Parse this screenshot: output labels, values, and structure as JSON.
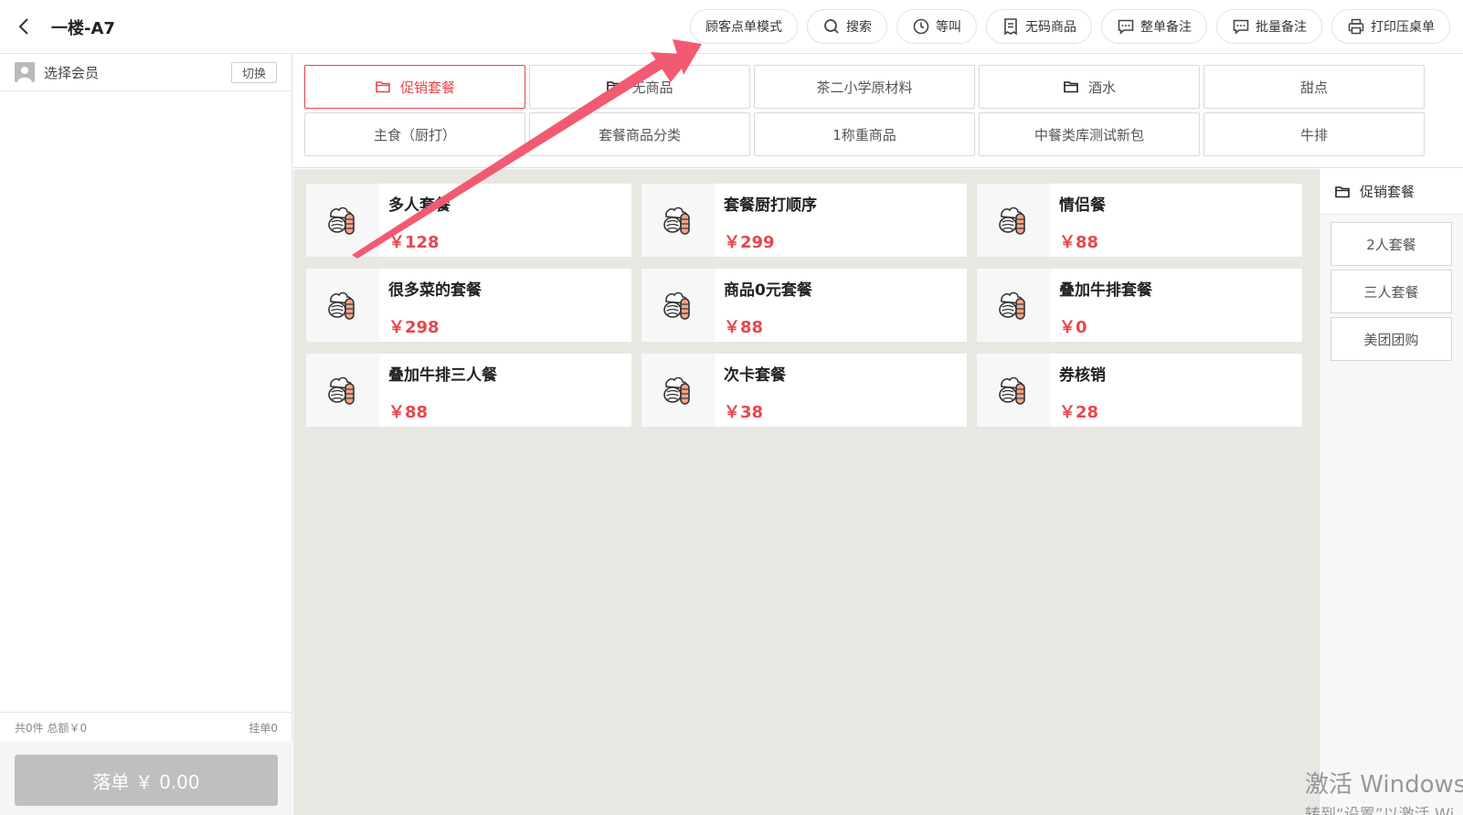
{
  "header": {
    "table_title": "一楼-A7",
    "actions": [
      {
        "label": "顾客点单模式",
        "icon": ""
      },
      {
        "label": "搜索",
        "icon": "search-icon"
      },
      {
        "label": "等叫",
        "icon": "clock-icon"
      },
      {
        "label": "无码商品",
        "icon": "receipt-icon"
      },
      {
        "label": "整单备注",
        "icon": "comment-icon"
      },
      {
        "label": "批量备注",
        "icon": "comment-icon"
      },
      {
        "label": "打印压桌单",
        "icon": "printer-icon"
      }
    ]
  },
  "member": {
    "label": "选择会员",
    "switch_label": "切换"
  },
  "summary": {
    "totals": "共0件 总额￥0",
    "held": "挂单0"
  },
  "submit": {
    "label": "落单 ￥ 0.00"
  },
  "categories": [
    {
      "label": "促销套餐",
      "folder": true,
      "active": true
    },
    {
      "label": "无商品",
      "folder": true,
      "active": false
    },
    {
      "label": "茶二小学原材料",
      "folder": false,
      "active": false
    },
    {
      "label": "酒水",
      "folder": true,
      "active": false
    },
    {
      "label": "甜点",
      "folder": false,
      "active": false
    },
    {
      "label": "主食（厨打）",
      "folder": false,
      "active": false
    },
    {
      "label": "套餐商品分类",
      "folder": false,
      "active": false
    },
    {
      "label": "1称重商品",
      "folder": false,
      "active": false
    },
    {
      "label": "中餐类库测试新包",
      "folder": false,
      "active": false
    },
    {
      "label": "牛排",
      "folder": false,
      "active": false
    }
  ],
  "products": [
    {
      "name": "多人套餐",
      "price": "￥128"
    },
    {
      "name": "套餐厨打顺序",
      "price": "￥299"
    },
    {
      "name": "情侣餐",
      "price": "￥88"
    },
    {
      "name": "很多菜的套餐",
      "price": "￥298"
    },
    {
      "name": "商品0元套餐",
      "price": "￥88"
    },
    {
      "name": "叠加牛排套餐",
      "price": "￥0"
    },
    {
      "name": "叠加牛排三人餐",
      "price": "￥88"
    },
    {
      "name": "次卡套餐",
      "price": "￥38"
    },
    {
      "name": "券核销",
      "price": "￥28"
    }
  ],
  "subcategory": {
    "title": "促销套餐",
    "items": [
      "2人套餐",
      "三人套餐",
      "美团团购"
    ]
  },
  "colors": {
    "accent": "#e8474c",
    "arrow": "#f25a72"
  },
  "watermark": {
    "line1": "激活 Windows",
    "line2": "转到“设置”以激活 Wi"
  }
}
